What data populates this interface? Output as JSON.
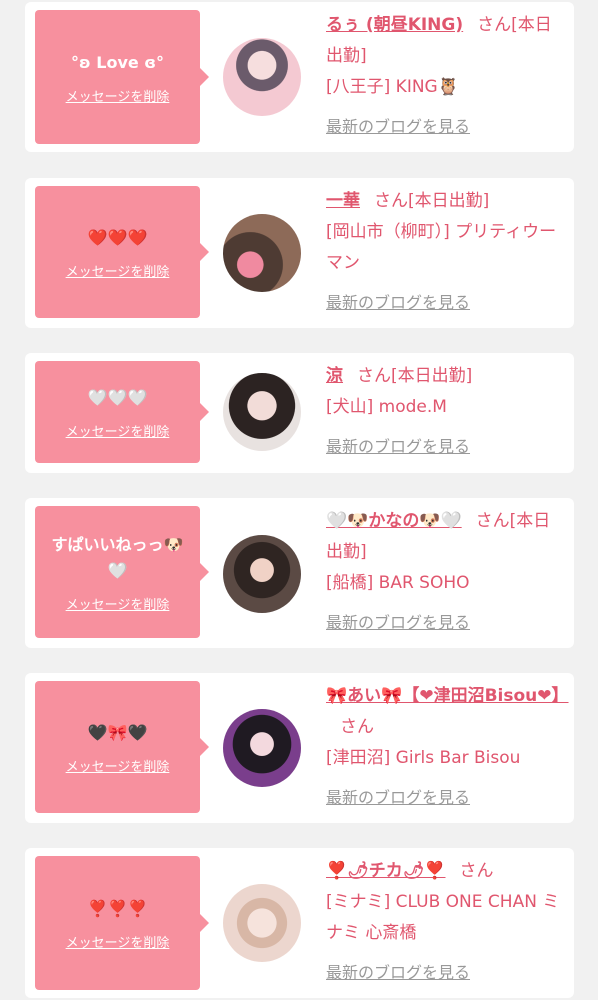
{
  "colors": {
    "accent": "#f7909e",
    "link": "#e0566e",
    "muted": "#999999",
    "bg": "#f1f1f1"
  },
  "delete_label": "メッセージを削除",
  "blog_label": "最新のブログを見る",
  "cards": [
    {
      "message": "°ʚ Love ɞ°",
      "name": "るぅ (朝昼KING)",
      "san": "さん[本日出勤]",
      "store": "[八王子] KING🦉"
    },
    {
      "message": "❤️❤️❤️",
      "name": "一華",
      "san": "さん[本日出勤]",
      "store": "[岡山市（柳町）] プリティウーマン"
    },
    {
      "message": "🤍🤍🤍",
      "name": "涼",
      "san": "さん[本日出勤]",
      "store": "[犬山] mode.M"
    },
    {
      "message": "すぱいいねっっ🐶🤍",
      "name": "🤍🐶かなの🐶🤍",
      "san": "さん[本日出勤]",
      "store": "[船橋] BAR SOHO"
    },
    {
      "message": "🖤🎀🖤",
      "name": "🎀あい🎀【❤津田沼Bisou❤】",
      "san": "さん",
      "store": "[津田沼] Girls Bar Bisou"
    },
    {
      "message": "❣️❣️❣️",
      "name": "❣️🌶チカ🌶❣️",
      "san": "さん",
      "store": "[ミナミ] CLUB ONE CHAN ミナミ 心斎橋"
    }
  ]
}
